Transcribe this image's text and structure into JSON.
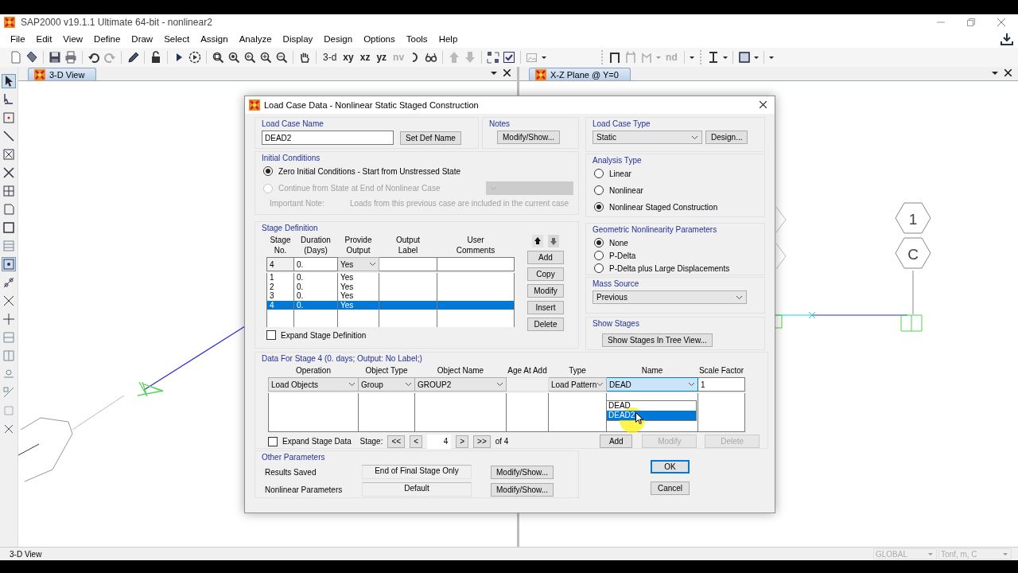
{
  "window": {
    "title": "SAP2000 v19.1.1 Ultimate 64-bit - nonlinear2"
  },
  "menu": [
    "File",
    "Edit",
    "View",
    "Define",
    "Draw",
    "Select",
    "Assign",
    "Analyze",
    "Display",
    "Design",
    "Options",
    "Tools",
    "Help"
  ],
  "toolbar": {
    "view_buttons": [
      {
        "label": "3-d",
        "disabled": false
      },
      {
        "label": "xy",
        "disabled": false
      },
      {
        "label": "xz",
        "disabled": false
      },
      {
        "label": "yz",
        "disabled": false
      },
      {
        "label": "nv",
        "disabled": true
      }
    ],
    "display_buttons": [
      {
        "label": "nd",
        "disabled": true
      }
    ]
  },
  "views": [
    {
      "title": "3-D View",
      "kind": "perspective"
    },
    {
      "title": "X-Z Plane @ Y=0",
      "kind": "plane",
      "grid_labels": [
        "1",
        "C"
      ]
    }
  ],
  "dialog": {
    "title": "Load Case Data - Nonlinear Static Staged Construction",
    "load_case_name": {
      "label": "Load Case Name",
      "value": "DEAD2",
      "button": "Set Def Name"
    },
    "notes": {
      "label": "Notes",
      "button": "Modify/Show..."
    },
    "initial_conditions": {
      "label": "Initial Conditions",
      "options": [
        {
          "label": "Zero Initial Conditions - Start from Unstressed State",
          "selected": true,
          "disabled": false
        },
        {
          "label": "Continue from State at End of Nonlinear Case",
          "selected": false,
          "disabled": true
        }
      ],
      "note_label": "Important Note:",
      "note": "Loads from this previous case are included in the current case"
    },
    "stage_definition": {
      "label": "Stage Definition",
      "columns": [
        [
          "Stage",
          "No."
        ],
        [
          "Duration",
          "(Days)"
        ],
        [
          "Provide",
          "Output"
        ],
        [
          "Output",
          "Label"
        ],
        [
          "User",
          "Comments"
        ]
      ],
      "edit_row": {
        "stage": "4",
        "duration": "0.",
        "output": "Yes"
      },
      "rows": [
        {
          "stage": "1",
          "duration": "0.",
          "output": "Yes",
          "selected": false
        },
        {
          "stage": "2",
          "duration": "0.",
          "output": "Yes",
          "selected": false
        },
        {
          "stage": "3",
          "duration": "0.",
          "output": "Yes",
          "selected": false
        },
        {
          "stage": "4",
          "duration": "0.",
          "output": "Yes",
          "selected": true
        }
      ],
      "buttons": [
        "Add",
        "Copy",
        "Modify",
        "Insert",
        "Delete"
      ],
      "expand": {
        "label": "Expand Stage Definition",
        "checked": false
      }
    },
    "stage_data": {
      "label": "Data For Stage 4  (0. days;  Output: No Label;)",
      "columns": [
        "Operation",
        "Object Type",
        "Object Name",
        "Age At Add",
        "Type",
        "Name",
        "Scale Factor"
      ],
      "edit_row": {
        "operation": "Load Objects",
        "object_type": "Group",
        "object_name": "GROUP2",
        "type": "Load Pattern",
        "name": "DEAD",
        "scale_factor": "1"
      },
      "name_options": [
        {
          "label": "DEAD",
          "selected": false
        },
        {
          "label": "DEAD2",
          "selected": true
        }
      ],
      "expand": {
        "label": "Expand Stage Data",
        "checked": false
      },
      "stage_nav": {
        "label": "Stage:",
        "first": "<<",
        "previous": "<",
        "value": "4",
        "next": ">",
        "last": ">>",
        "total": "of 4"
      },
      "buttons": [
        {
          "label": "Add",
          "disabled": false
        },
        {
          "label": "Modify",
          "disabled": true
        },
        {
          "label": "Delete",
          "disabled": true
        }
      ]
    },
    "other_parameters": {
      "label": "Other Parameters",
      "rows": [
        {
          "label": "Results Saved",
          "value": "End of Final Stage Only",
          "button": "Modify/Show..."
        },
        {
          "label": "Nonlinear Parameters",
          "value": "Default",
          "button": "Modify/Show..."
        }
      ]
    },
    "load_case_type": {
      "label": "Load Case Type",
      "value": "Static",
      "button": "Design..."
    },
    "analysis_type": {
      "label": "Analysis Type",
      "options": [
        {
          "label": "Linear",
          "selected": false
        },
        {
          "label": "Nonlinear",
          "selected": false
        },
        {
          "label": "Nonlinear Staged Construction",
          "selected": true
        }
      ]
    },
    "geometric_nonlinearity": {
      "label": "Geometric Nonlinearity Parameters",
      "options": [
        {
          "label": "None",
          "selected": true
        },
        {
          "label": "P-Delta",
          "selected": false
        },
        {
          "label": "P-Delta plus Large Displacements",
          "selected": false
        }
      ]
    },
    "mass_source": {
      "label": "Mass Source",
      "value": "Previous"
    },
    "show_stages": {
      "label": "Show Stages",
      "button": "Show Stages In Tree View..."
    },
    "buttons": [
      {
        "label": "OK",
        "default": true
      },
      {
        "label": "Cancel",
        "default": false
      }
    ]
  },
  "status_bar": {
    "view": "3-D View",
    "coordinate_system": "GLOBAL",
    "units": "Tonf, m, C"
  }
}
